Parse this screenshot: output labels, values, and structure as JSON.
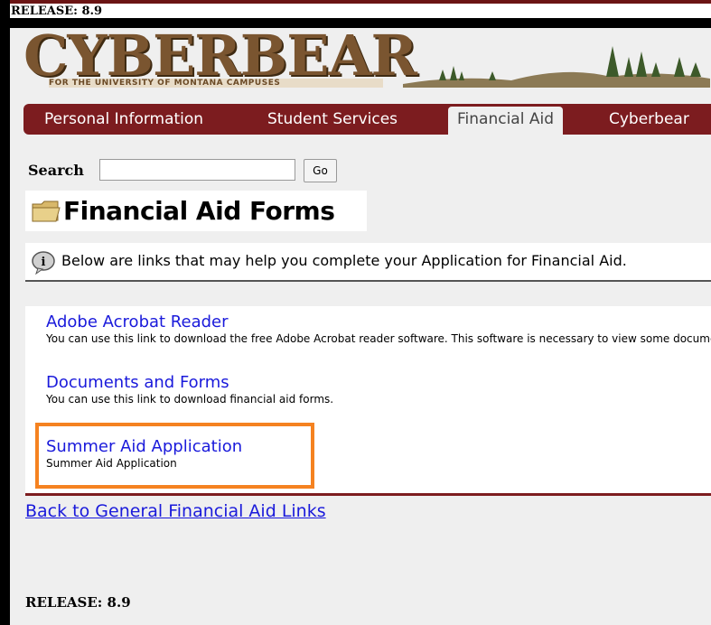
{
  "release_top": "RELEASE: 8.9",
  "logo": {
    "title": "CYBERBEAR",
    "subtitle": "FOR THE UNIVERSITY OF MONTANA CAMPUSES"
  },
  "tabs": [
    {
      "label": "Personal Information",
      "active": false
    },
    {
      "label": "Student Services",
      "active": false
    },
    {
      "label": "Financial Aid",
      "active": true
    },
    {
      "label": "Cyberbear",
      "active": false
    }
  ],
  "search": {
    "label": "Search",
    "value": "",
    "go_label": "Go"
  },
  "page_title": "Financial Aid Forms",
  "info_text": "Below are links that may help you complete your Application for Financial Aid.",
  "links": [
    {
      "title": "Adobe Acrobat Reader",
      "description": "You can use this link to download the free Adobe Acrobat reader software. This software is necessary to view some documents."
    },
    {
      "title": "Documents and Forms",
      "description": "You can use this link to download financial aid forms."
    },
    {
      "title": "Summer Aid Application",
      "description": "Summer Aid Application"
    }
  ],
  "back_link": "Back to General Financial Aid Links",
  "release_bottom": "RELEASE: 8.9",
  "colors": {
    "tab_bar": "#7c1c1f",
    "link": "#1a1adb",
    "highlight": "#f58220"
  }
}
